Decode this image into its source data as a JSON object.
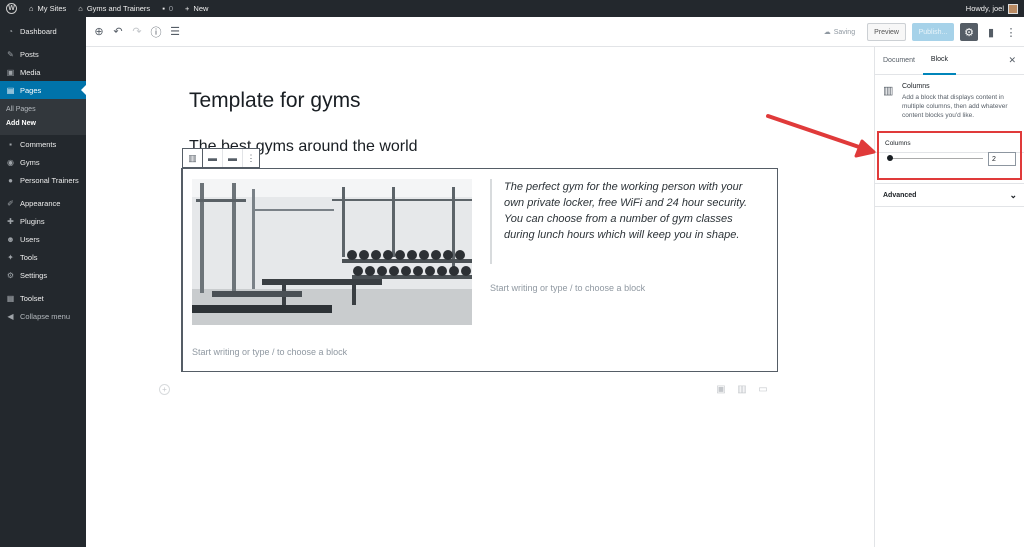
{
  "admin_bar": {
    "my_sites": "My Sites",
    "site_name": "Gyms and Trainers",
    "comments_count": "0",
    "new_label": "New",
    "greeting": "Howdy, joel"
  },
  "sidebar": {
    "items": [
      {
        "label": "Dashboard",
        "icon": "dashboard-icon"
      },
      {
        "label": "Posts",
        "icon": "pin-icon"
      },
      {
        "label": "Media",
        "icon": "media-icon"
      },
      {
        "label": "Pages",
        "icon": "pages-icon"
      },
      {
        "label": "Comments",
        "icon": "comments-icon"
      },
      {
        "label": "Gyms",
        "icon": "gyms-icon"
      },
      {
        "label": "Personal Trainers",
        "icon": "trainers-icon"
      },
      {
        "label": "Appearance",
        "icon": "brush-icon"
      },
      {
        "label": "Plugins",
        "icon": "plug-icon"
      },
      {
        "label": "Users",
        "icon": "users-icon"
      },
      {
        "label": "Tools",
        "icon": "wrench-icon"
      },
      {
        "label": "Settings",
        "icon": "settings-icon"
      },
      {
        "label": "Toolset",
        "icon": "toolset-icon"
      },
      {
        "label": "Collapse menu",
        "icon": "collapse-icon"
      }
    ],
    "pages_submenu": [
      "All Pages",
      "Add New"
    ]
  },
  "editor_header": {
    "saving_label": "Saving",
    "preview_label": "Preview",
    "publish_label": "Publish..."
  },
  "content": {
    "title": "Template for gyms",
    "heading": "The best gyms around the world",
    "quote": "The perfect gym for the working person with your own private locker, free WiFi and 24 hour security. You can choose from a number of gym classes during lunch hours which will keep you in shape.",
    "placeholder_right": "Start writing or type / to choose a block",
    "placeholder_bottom": "Start writing or type / to choose a block"
  },
  "settings_sidebar": {
    "tab_document": "Document",
    "tab_block": "Block",
    "block_title": "Columns",
    "block_description": "Add a block that displays content in multiple columns, then add whatever content blocks you'd like.",
    "columns_label": "Columns",
    "columns_value": "2",
    "advanced_label": "Advanced"
  },
  "colors": {
    "admin_dark": "#23282d",
    "accent_blue": "#0073aa",
    "highlight_red": "#e03a3a"
  }
}
